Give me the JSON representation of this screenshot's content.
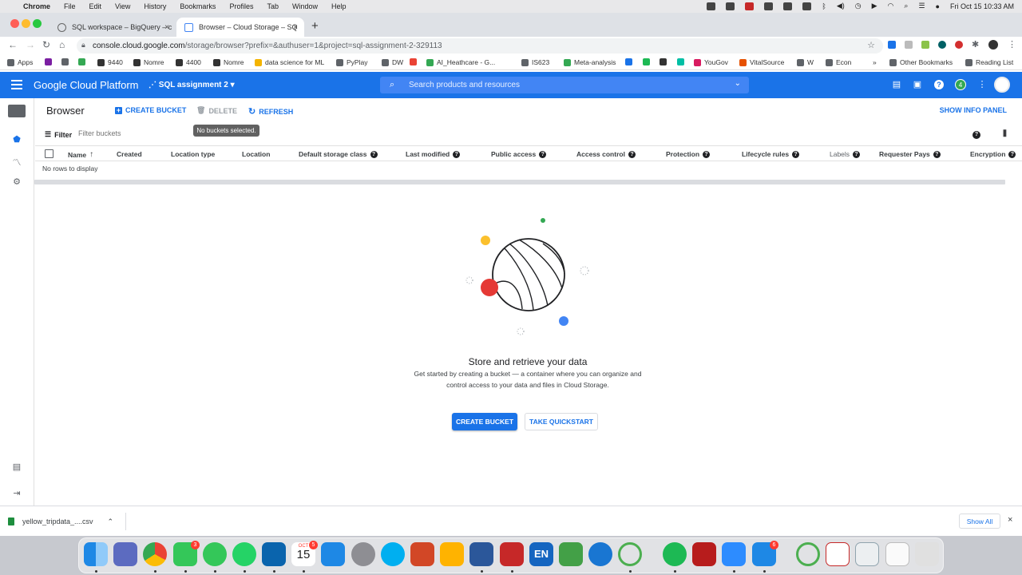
{
  "menubar": {
    "app": "Chrome",
    "items": [
      "File",
      "Edit",
      "View",
      "History",
      "Bookmarks",
      "Profiles",
      "Tab",
      "Window",
      "Help"
    ],
    "clock": "Fri Oct 15  10:33 AM"
  },
  "tabs": [
    {
      "title": "SQL workspace – BigQuery – c",
      "close": "×"
    },
    {
      "title": "Browser – Cloud Storage – SQ",
      "close": "×"
    }
  ],
  "new_tab": "+",
  "address": {
    "host": "console.cloud.google.com",
    "path": "/storage/browser?prefix=&authuser=1&project=sql-assignment-2-329113"
  },
  "bookmarks": {
    "items": [
      {
        "label": "Apps",
        "color": "#5f6368"
      },
      {
        "label": "",
        "color": "#7b1fa2"
      },
      {
        "label": "",
        "color": "#5f6368"
      },
      {
        "label": "",
        "color": "#34a853"
      },
      {
        "label": "9440",
        "color": "#333333"
      },
      {
        "label": "Nomre",
        "color": "#333333"
      },
      {
        "label": "4400",
        "color": "#333333"
      },
      {
        "label": "Nomre",
        "color": "#333333"
      },
      {
        "label": "data science for ML",
        "color": "#f4b400"
      },
      {
        "label": "PyPlay",
        "color": "#5f6368"
      },
      {
        "label": "DW",
        "color": "#5f6368"
      },
      {
        "label": "",
        "color": "#ea4335"
      },
      {
        "label": "AI_Heathcare - G...",
        "color": "#34a853"
      },
      {
        "label": "IS623",
        "color": "#5f6368"
      },
      {
        "label": "Meta-analysis",
        "color": "#34a853"
      },
      {
        "label": "",
        "color": "#1a73e8"
      },
      {
        "label": "",
        "color": "#1db954"
      },
      {
        "label": "",
        "color": "#333333"
      },
      {
        "label": "",
        "color": "#00bfa5"
      },
      {
        "label": "YouGov",
        "color": "#d81b60"
      },
      {
        "label": "VitalSource",
        "color": "#e65100"
      },
      {
        "label": "W",
        "color": "#5f6368"
      },
      {
        "label": "Econ",
        "color": "#5f6368"
      }
    ],
    "more": "»",
    "other": "Other Bookmarks",
    "reading": "Reading List"
  },
  "gcp": {
    "brand": "Google Cloud Platform",
    "project": "SQL assignment 2",
    "search_placeholder": "Search products and resources",
    "notification_count": "4"
  },
  "toolbar": {
    "title": "Browser",
    "create": "CREATE BUCKET",
    "delete": "DELETE",
    "refresh": "REFRESH",
    "tooltip": "No buckets selected.",
    "show_info": "SHOW INFO PANEL"
  },
  "filter": {
    "label": "Filter",
    "placeholder": "Filter buckets"
  },
  "table": {
    "columns": [
      "Name",
      "Created",
      "Location type",
      "Location",
      "Default storage class",
      "Last modified",
      "Public access",
      "Access control",
      "Protection",
      "Lifecycle rules",
      "Labels",
      "Requester Pays",
      "Encryption"
    ],
    "sort_arrow": "↑",
    "empty": "No rows to display"
  },
  "empty_state": {
    "title": "Store and retrieve your data",
    "line1": "Get started by creating a bucket — a container where you can organize and",
    "line2": "control access to your data and files in Cloud Storage.",
    "create": "CREATE BUCKET",
    "quickstart": "TAKE QUICKSTART"
  },
  "downloads": {
    "file": "yellow_tripdata_....csv",
    "show_all": "Show All",
    "close": "×"
  },
  "dock": {
    "badges": {
      "facetime": "3",
      "calendar_month": "OCT",
      "calendar_day": "15",
      "calendar_badge": "5",
      "mail": "6"
    },
    "calendar_letters": "EN"
  },
  "colors": {
    "gcp_blue": "#1a73e8",
    "illus_red": "#e53935",
    "illus_yellow": "#fbc02d",
    "illus_green": "#34a853",
    "illus_blue": "#4285f4"
  }
}
